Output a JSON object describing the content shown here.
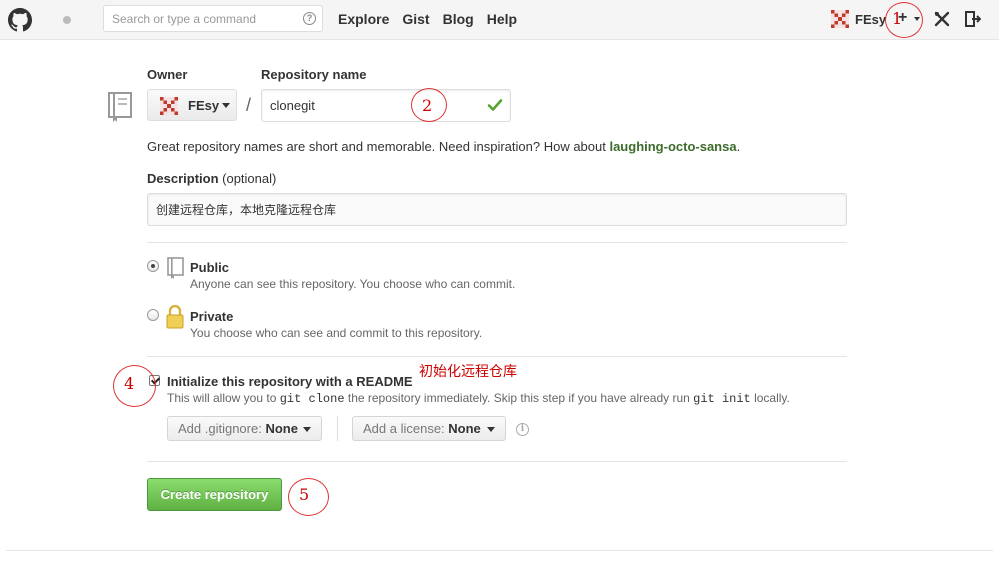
{
  "header": {
    "search_placeholder": "Search or type a command",
    "search_help": "?",
    "nav": [
      "Explore",
      "Gist",
      "Blog",
      "Help"
    ],
    "username": "FEsy",
    "plus": "+"
  },
  "form": {
    "owner_label": "Owner",
    "owner_value": "FEsy",
    "slash": "/",
    "repo_name_label": "Repository name",
    "repo_name_value": "clonegit",
    "hint_text": "Great repository names are short and memorable. Need inspiration? How about ",
    "hint_suggestion": "laughing-octo-sansa",
    "hint_end": ".",
    "description_label": "Description",
    "description_optional": "(optional)",
    "description_value": "创建远程仓库，本地克隆远程仓库",
    "visibility": [
      {
        "title": "Public",
        "desc": "Anyone can see this repository. You choose who can commit.",
        "selected": true
      },
      {
        "title": "Private",
        "desc": "You choose who can see and commit to this repository.",
        "selected": false
      }
    ],
    "init_readme_label": "Initialize this repository with a README",
    "init_readme_checked": true,
    "init_desc_1": "This will allow you to ",
    "init_code_1": "git clone",
    "init_desc_2": " the repository immediately. Skip this step if you have already run ",
    "init_code_2": "git init",
    "init_desc_3": " locally.",
    "gitignore_label": "Add .gitignore: ",
    "gitignore_value": "None",
    "license_label": "Add a license: ",
    "license_value": "None",
    "create_button": "Create repository"
  },
  "annotations": {
    "n1": "1",
    "n2": "2",
    "n4": "4",
    "n5": "5",
    "readme_note": "初始化远程仓库"
  },
  "colors": {
    "success_green": "#60b044",
    "suggestion_green": "#3d6b2a",
    "annotation_red": "#cc0000"
  }
}
